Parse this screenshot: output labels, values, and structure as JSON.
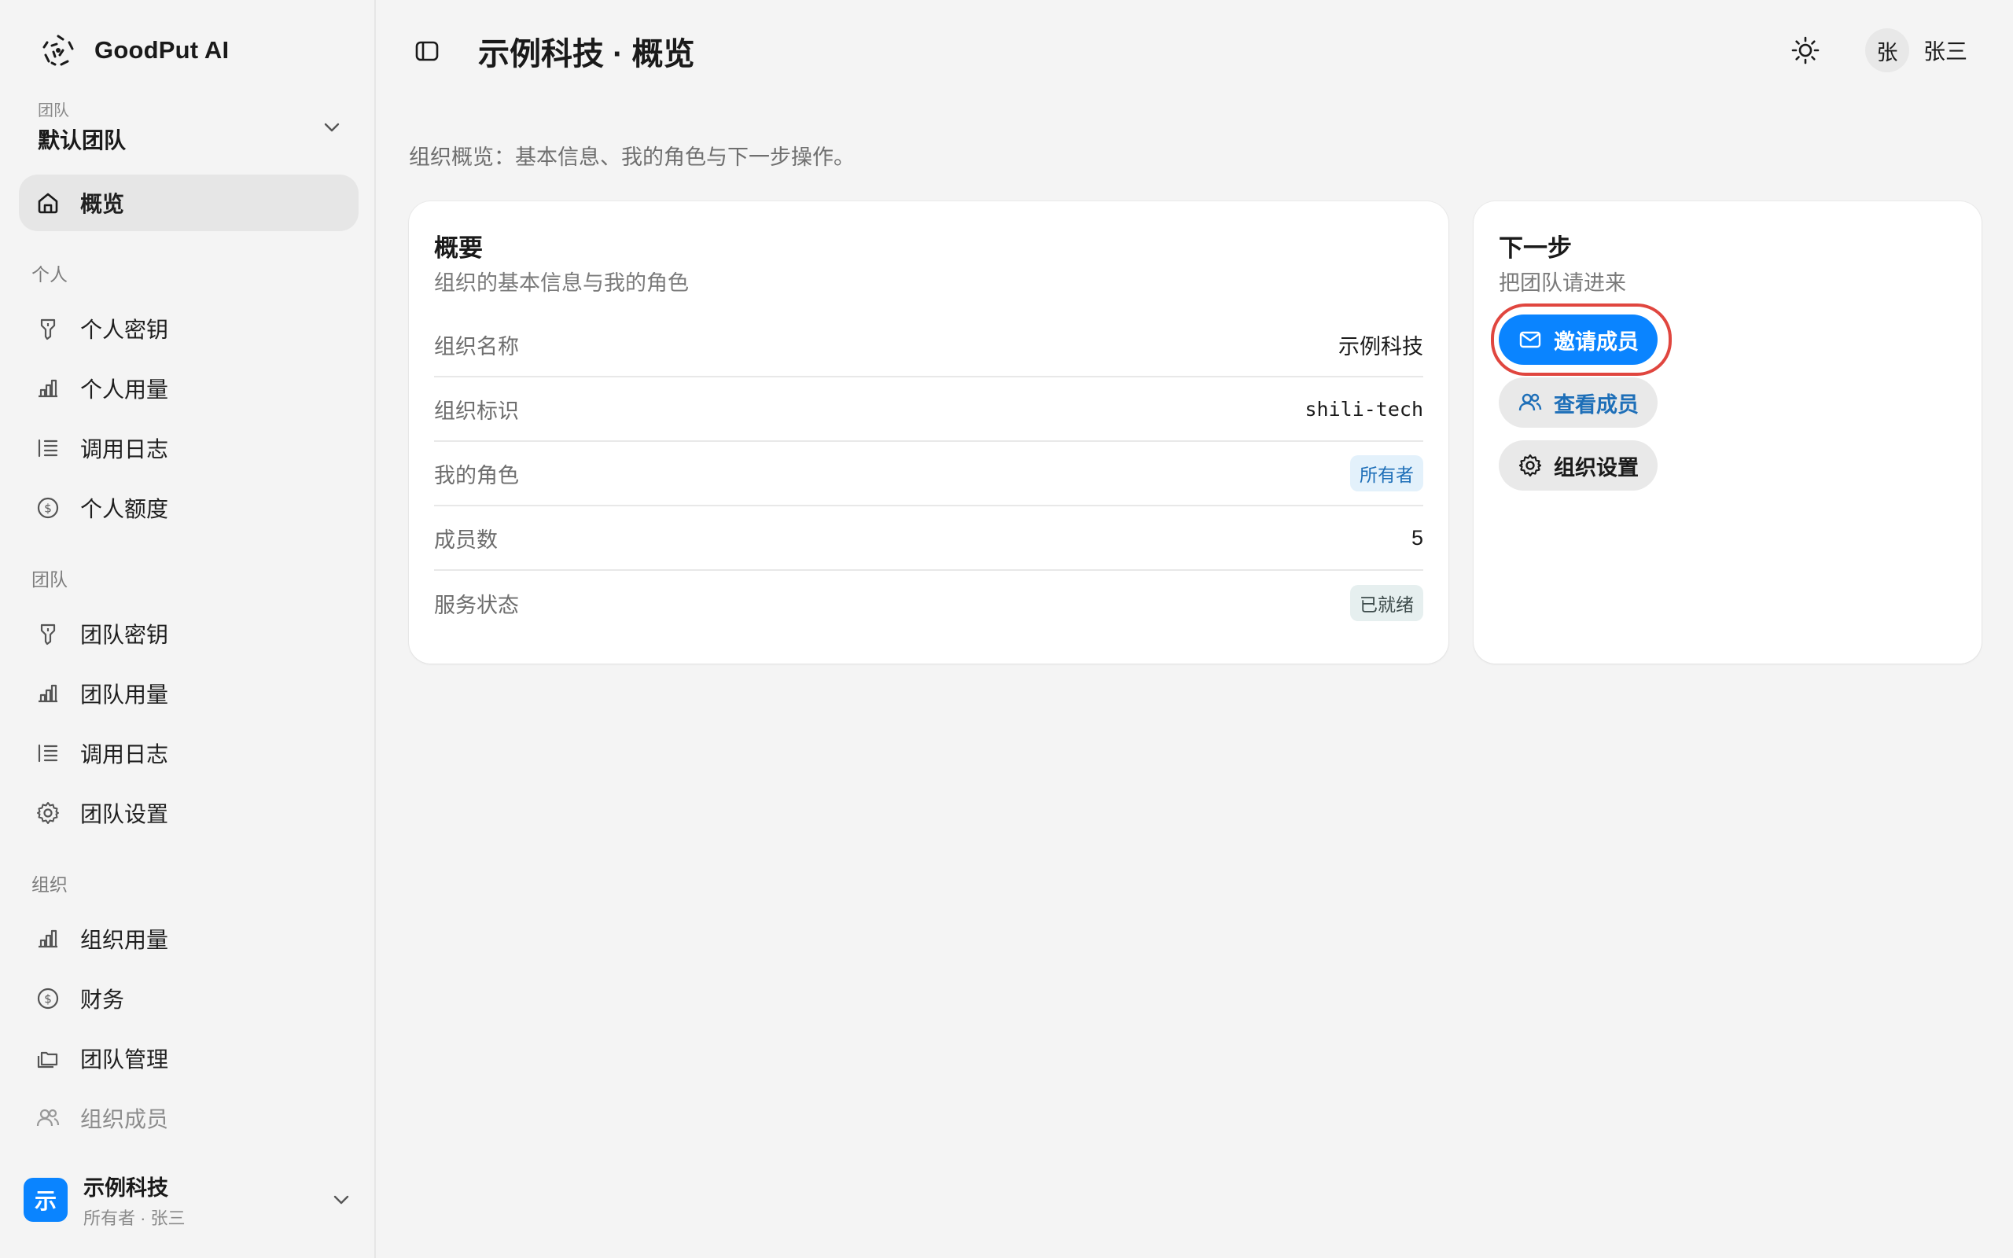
{
  "app": {
    "name": "GoodPut AI"
  },
  "team_switch": {
    "label": "团队",
    "value": "默认团队"
  },
  "nav": {
    "overview": "概览",
    "personal_section": "个人",
    "personal": [
      "个人密钥",
      "个人用量",
      "调用日志",
      "个人额度"
    ],
    "team_section": "团队",
    "team": [
      "团队密钥",
      "团队用量",
      "调用日志",
      "团队设置"
    ],
    "org_section": "组织",
    "org": [
      "组织用量",
      "财务",
      "团队管理",
      "组织成员"
    ]
  },
  "org_footer": {
    "badge": "示",
    "name": "示例科技",
    "sub": "所有者 · 张三"
  },
  "header": {
    "title": "示例科技 · 概览",
    "user_avatar": "张",
    "user_name": "张三"
  },
  "page": {
    "description": "组织概览：基本信息、我的角色与下一步操作。"
  },
  "summary": {
    "title": "概要",
    "subtitle": "组织的基本信息与我的角色",
    "rows": [
      {
        "key": "组织名称",
        "value": "示例科技"
      },
      {
        "key": "组织标识",
        "value": "shili-tech"
      },
      {
        "key": "我的角色",
        "value": "所有者"
      },
      {
        "key": "成员数",
        "value": "5"
      },
      {
        "key": "服务状态",
        "value": "已就绪"
      }
    ]
  },
  "next_steps": {
    "title": "下一步",
    "subtitle": "把团队请进来",
    "invite": "邀请成员",
    "view_members": "查看成员",
    "org_settings": "组织设置"
  },
  "colors": {
    "accent": "#0a84ff",
    "highlight": "#e0463f",
    "owner_badge": "#1e6fb8"
  }
}
